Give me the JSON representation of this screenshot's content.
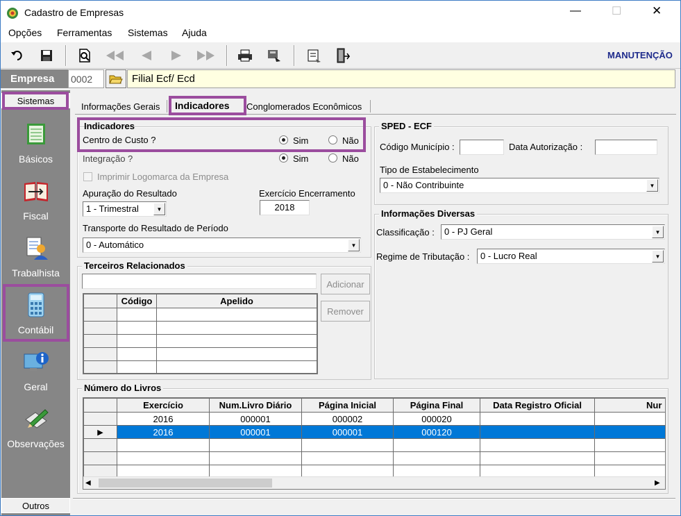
{
  "window": {
    "title": "Cadastro de Empresas",
    "controls": {
      "minimize": "—",
      "maximize": "☐",
      "close": "✕"
    }
  },
  "menu": [
    "Opções",
    "Ferramentas",
    "Sistemas",
    "Ajuda"
  ],
  "toolbar": {
    "mode_label": "MANUTENÇÃO"
  },
  "empresa": {
    "label": "Empresa",
    "code": "0002",
    "name": "Filial Ecf/ Ecd"
  },
  "sidebar": {
    "header": "Sistemas",
    "footer": "Outros",
    "items": [
      {
        "label": "Básicos"
      },
      {
        "label": "Fiscal"
      },
      {
        "label": "Trabalhista"
      },
      {
        "label": "Contábil"
      },
      {
        "label": "Geral"
      },
      {
        "label": "Observações"
      }
    ]
  },
  "tabs": [
    "Informações Gerais",
    "Indicadores",
    "Conglomerados Econômicos"
  ],
  "indicadores": {
    "title": "Indicadores",
    "centro_custo": {
      "label": "Centro de Custo ?",
      "sim": "Sim",
      "nao": "Não",
      "selected": "Sim"
    },
    "integracao": {
      "label": "Integração ?",
      "sim": "Sim",
      "nao": "Não",
      "selected": "Sim"
    },
    "imprimir_logo": {
      "label": "Imprimir Logomarca da Empresa",
      "checked": false
    },
    "apuracao": {
      "label": "Apuração do Resultado",
      "value": "1 - Trimestral"
    },
    "exercicio": {
      "label": "Exercício Encerramento",
      "value": "2018"
    },
    "transporte": {
      "label": "Transporte do Resultado de Período",
      "value": "0 - Automático"
    }
  },
  "terceiros": {
    "title": "Terceiros Relacionados",
    "input_value": "",
    "add_button": "Adicionar",
    "remove_button": "Remover",
    "columns": [
      "Código",
      "Apelido"
    ]
  },
  "sped": {
    "title": "SPED - ECF",
    "cod_municipio_label": "Código Município :",
    "cod_municipio_value": "",
    "data_aut_label": "Data Autorização :",
    "data_aut_value": "",
    "tipo_label": "Tipo de Estabelecimento",
    "tipo_value": "0 - Não Contribuinte"
  },
  "diversas": {
    "title": "Informações Diversas",
    "classificacao_label": "Classificação :",
    "classificacao_value": "0 - PJ Geral",
    "regime_label": "Regime de Tributação :",
    "regime_value": "0 - Lucro Real"
  },
  "livros": {
    "title": "Número do Livros",
    "columns": [
      "Exercício",
      "Num.Livro Diário",
      "Página Inicial",
      "Página Final",
      "Data Registro Oficial",
      "Nur"
    ],
    "rows": [
      [
        "2016",
        "000001",
        "000002",
        "000020",
        ""
      ],
      [
        "2016",
        "000001",
        "000001",
        "000120",
        ""
      ]
    ],
    "selected_row": 1
  },
  "colors": {
    "highlight": "#9b4d9e",
    "selection": "#0078d7",
    "sidebar": "#868686",
    "mode": "#1e2b8c"
  }
}
